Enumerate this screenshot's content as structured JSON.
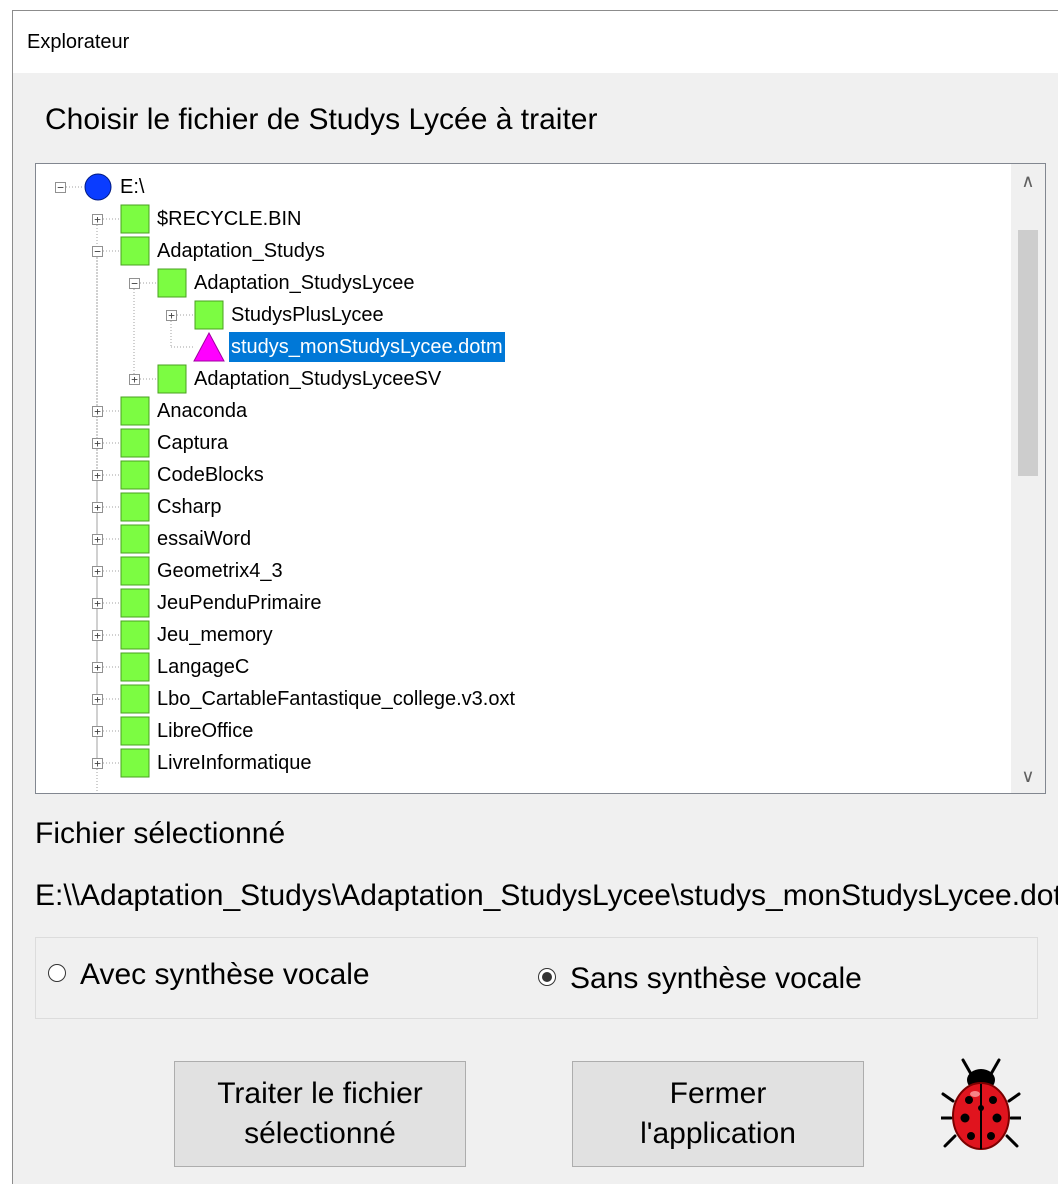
{
  "window": {
    "title": "Explorateur"
  },
  "heading": "Choisir le fichier de Studys Lycée à traiter",
  "tree": {
    "items": [
      {
        "label": "E:\\",
        "level": 0,
        "icon": "drive-icon",
        "expander": "collapse"
      },
      {
        "label": "$RECYCLE.BIN",
        "level": 1,
        "icon": "folder-icon",
        "expander": "expand"
      },
      {
        "label": "Adaptation_Studys",
        "level": 1,
        "icon": "folder-icon",
        "expander": "collapse"
      },
      {
        "label": "Adaptation_StudysLycee",
        "level": 2,
        "icon": "folder-icon",
        "expander": "collapse"
      },
      {
        "label": "StudysPlusLycee",
        "level": 3,
        "icon": "folder-icon",
        "expander": "expand"
      },
      {
        "label": "studys_monStudysLycee.dotm",
        "level": 3,
        "icon": "file-icon",
        "expander": "none",
        "selected": true
      },
      {
        "label": "Adaptation_StudysLyceeSV",
        "level": 2,
        "icon": "folder-icon",
        "expander": "expand"
      },
      {
        "label": "Anaconda",
        "level": 1,
        "icon": "folder-icon",
        "expander": "expand"
      },
      {
        "label": "Captura",
        "level": 1,
        "icon": "folder-icon",
        "expander": "expand"
      },
      {
        "label": "CodeBlocks",
        "level": 1,
        "icon": "folder-icon",
        "expander": "expand"
      },
      {
        "label": "Csharp",
        "level": 1,
        "icon": "folder-icon",
        "expander": "expand"
      },
      {
        "label": "essaiWord",
        "level": 1,
        "icon": "folder-icon",
        "expander": "expand"
      },
      {
        "label": "Geometrix4_3",
        "level": 1,
        "icon": "folder-icon",
        "expander": "expand"
      },
      {
        "label": "JeuPenduPrimaire",
        "level": 1,
        "icon": "folder-icon",
        "expander": "expand"
      },
      {
        "label": "Jeu_memory",
        "level": 1,
        "icon": "folder-icon",
        "expander": "expand"
      },
      {
        "label": "LangageC",
        "level": 1,
        "icon": "folder-icon",
        "expander": "expand"
      },
      {
        "label": "Lbo_CartableFantastique_college.v3.oxt",
        "level": 1,
        "icon": "folder-icon",
        "expander": "expand"
      },
      {
        "label": "LibreOffice",
        "level": 1,
        "icon": "folder-icon",
        "expander": "expand"
      },
      {
        "label": "LivreInformatique",
        "level": 1,
        "icon": "folder-icon",
        "expander": "expand"
      }
    ]
  },
  "selected": {
    "label": "Fichier sélectionné",
    "path": "E:\\\\Adaptation_Studys\\Adaptation_StudysLycee\\studys_monStudysLycee.dotm"
  },
  "options": {
    "with_voice": "Avec synthèse vocale",
    "without_voice": "Sans synthèse vocale",
    "selected": "without_voice"
  },
  "buttons": {
    "process": [
      "Traiter le fichier",
      "sélectionné"
    ],
    "close": [
      "Fermer",
      "l'application"
    ]
  },
  "colors": {
    "drive": "#0a3cff",
    "folder": "#7cfc42",
    "file": "#ff00ff",
    "selection": "#0078d7",
    "ladybug": "#e0141e"
  },
  "icons": {
    "logo": "ladybug-icon"
  }
}
